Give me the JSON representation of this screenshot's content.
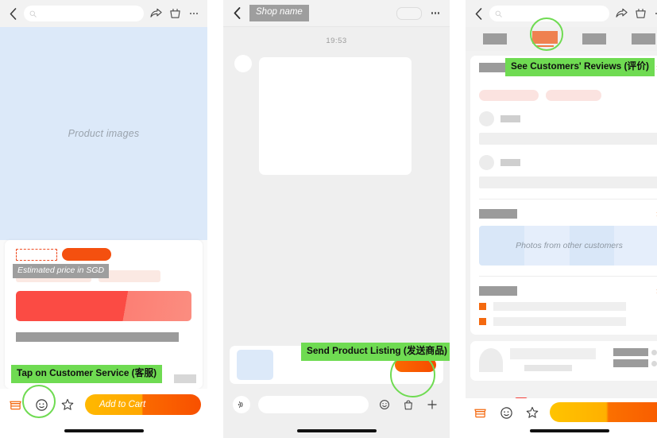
{
  "panels": {
    "left": {
      "name": "product-detail-page",
      "nav": {
        "back_icon": "chevron-left-icon",
        "search_placeholder": "",
        "share_icon": "share-icon",
        "cart_icon": "cart-icon",
        "more_icon": "more-dots-icon"
      },
      "hero_label": "Product images",
      "annotations": {
        "price": "Estimated price in SGD",
        "customer_service": "Tap on Customer Service (客服)"
      },
      "bottom": {
        "shop_icon": "storefront-icon",
        "customer_service_icon": "customer-service-chat-icon",
        "favorite_icon": "star-icon",
        "cta_label": "Add to Cart"
      }
    },
    "middle": {
      "name": "chat-page",
      "nav": {
        "back_icon": "chevron-left-icon",
        "shop_name": "Shop name",
        "toggle_icon": "pill-toggle",
        "more_icon": "more-dots-icon"
      },
      "timestamp": "19:53",
      "annotations": {
        "send": "Send Product Listing (发送商品)"
      },
      "input_row": {
        "voice_icon": "voice-wave-icon",
        "emoji_icon": "smiley-icon",
        "bag_icon": "shopping-bag-icon",
        "plus_icon": "plus-icon"
      }
    },
    "right": {
      "name": "product-reviews-page",
      "nav": {
        "back_icon": "chevron-left-icon",
        "search_placeholder": "",
        "share_icon": "share-icon",
        "cart_icon": "cart-icon",
        "more_icon": "more-dots-icon"
      },
      "tabs": {
        "active_index": 1,
        "count": 4
      },
      "annotations": {
        "reviews": "See Customers' Reviews (评价)"
      },
      "photo_strip_label": "Photos from other customers",
      "bottom": {
        "shop_icon": "storefront-icon",
        "customer_service_icon": "customer-service-chat-icon",
        "favorite_icon": "star-icon",
        "cta_label": ""
      }
    }
  },
  "colors": {
    "highlight_green": "#6fdb52",
    "annotation_gray": "#9e9e9e",
    "brand_orange": "#f4500f",
    "hero_blue": "#dce9f9",
    "accent_red": "#fb4b44"
  }
}
